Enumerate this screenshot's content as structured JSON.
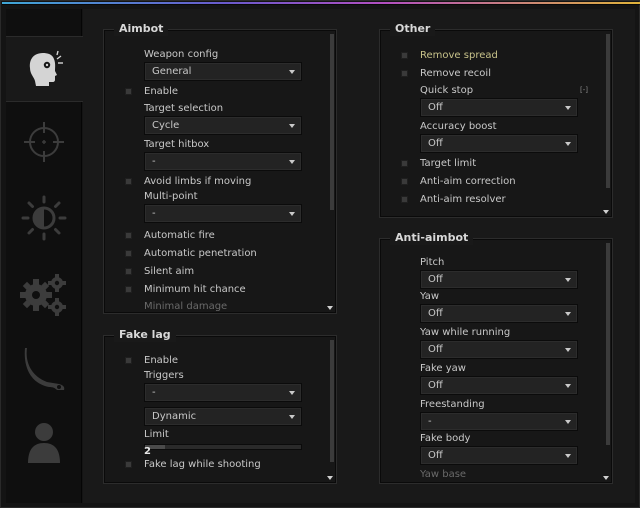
{
  "tabs": [
    {
      "icon": "head-target-icon",
      "active": true
    },
    {
      "icon": "crosshair-icon",
      "active": false
    },
    {
      "icon": "brightness-icon",
      "active": false
    },
    {
      "icon": "gears-icon",
      "active": false
    },
    {
      "icon": "knife-icon",
      "active": false
    },
    {
      "icon": "player-icon",
      "active": false
    }
  ],
  "aimbot": {
    "title": "Aimbot",
    "weapon_config_label": "Weapon config",
    "weapon_config_value": "General",
    "enable_label": "Enable",
    "target_selection_label": "Target selection",
    "target_selection_value": "Cycle",
    "target_hitbox_label": "Target hitbox",
    "target_hitbox_value": "-",
    "avoid_limbs_label": "Avoid limbs if moving",
    "multipoint_label": "Multi-point",
    "multipoint_value": "-",
    "automatic_fire_label": "Automatic fire",
    "automatic_penetration_label": "Automatic penetration",
    "silent_aim_label": "Silent aim",
    "min_hit_chance_label": "Minimum hit chance",
    "minimal_damage_label": "Minimal damage"
  },
  "fakelag": {
    "title": "Fake lag",
    "enable_label": "Enable",
    "triggers_label": "Triggers",
    "triggers_value": "-",
    "mode_value": "Dynamic",
    "limit_label": "Limit",
    "limit_value": "2",
    "limit_fraction": 0.13,
    "while_shooting_label": "Fake lag while shooting"
  },
  "other": {
    "title": "Other",
    "remove_spread_label": "Remove spread",
    "remove_recoil_label": "Remove recoil",
    "quick_stop_label": "Quick stop",
    "quick_stop_key": "[-]",
    "quick_stop_value": "Off",
    "accuracy_boost_label": "Accuracy boost",
    "accuracy_boost_value": "Off",
    "target_limit_label": "Target limit",
    "antiaim_correction_label": "Anti-aim correction",
    "antiaim_resolver_label": "Anti-aim resolver"
  },
  "antiaim": {
    "title": "Anti-aimbot",
    "pitch_label": "Pitch",
    "pitch_value": "Off",
    "yaw_label": "Yaw",
    "yaw_value": "Off",
    "yaw_running_label": "Yaw while running",
    "yaw_running_value": "Off",
    "fake_yaw_label": "Fake yaw",
    "fake_yaw_value": "Off",
    "freestanding_label": "Freestanding",
    "freestanding_value": "-",
    "fake_body_label": "Fake body",
    "fake_body_value": "Off",
    "yaw_base_label": "Yaw base"
  },
  "colors": {
    "accent_text": "#c7c28a",
    "rainbow": [
      "#3fa7d6",
      "#6a5acd",
      "#b34fc1",
      "#e0b33a"
    ]
  }
}
